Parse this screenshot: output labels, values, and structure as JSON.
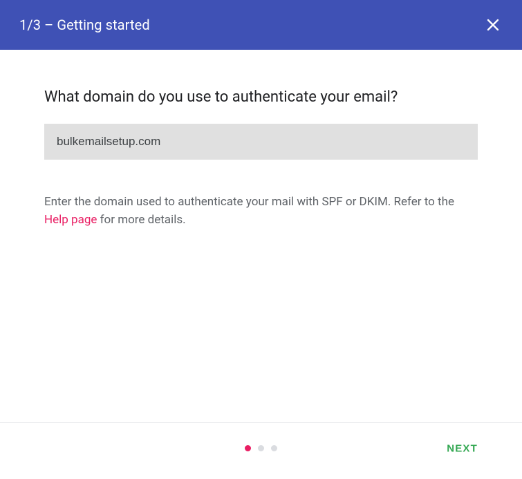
{
  "header": {
    "title": "1/3 – Getting started"
  },
  "main": {
    "question": "What domain do you use to authenticate your email?",
    "domain_value": "bulkemailsetup.com",
    "help_prefix": "Enter the domain used to authenticate your mail with SPF or DKIM. Refer to the ",
    "help_link_text": "Help page",
    "help_suffix": " for more details."
  },
  "footer": {
    "next_label": "NEXT",
    "step_count": 3,
    "active_step": 1
  },
  "colors": {
    "primary": "#3F51B5",
    "accent": "#e91e63",
    "next": "#34a853"
  }
}
